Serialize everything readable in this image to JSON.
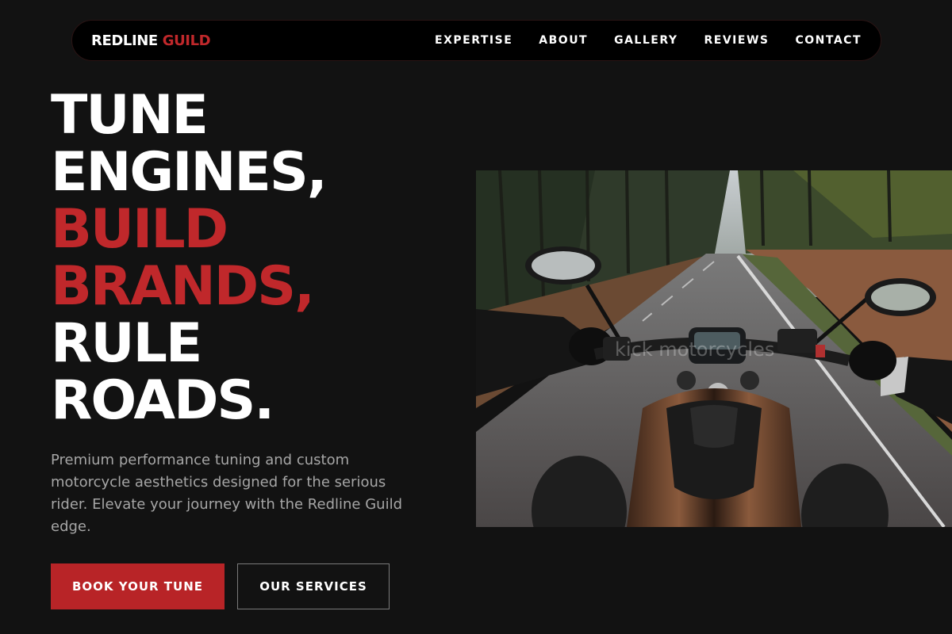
{
  "nav": {
    "logo_main": "REDLINE ",
    "logo_accent": "GUILD",
    "links": [
      "EXPERTISE",
      "ABOUT",
      "GALLERY",
      "REVIEWS",
      "CONTACT"
    ]
  },
  "hero": {
    "headline_lines": [
      "TUNE",
      "ENGINES,",
      "BUILD",
      "BRANDS,",
      "RULE",
      "ROADS."
    ],
    "description": "Premium performance tuning and custom motorcycle aesthetics designed for the serious rider. Elevate your journey with the Redline Guild edge.",
    "primary_button": "BOOK YOUR TUNE",
    "secondary_button": "OUR SERVICES"
  },
  "photo": {
    "watermark": "kick motorcycles"
  },
  "colors": {
    "background": "#121212",
    "accent": "#c0282b",
    "nav_background": "#000000",
    "body_text": "#a6a6a6"
  }
}
